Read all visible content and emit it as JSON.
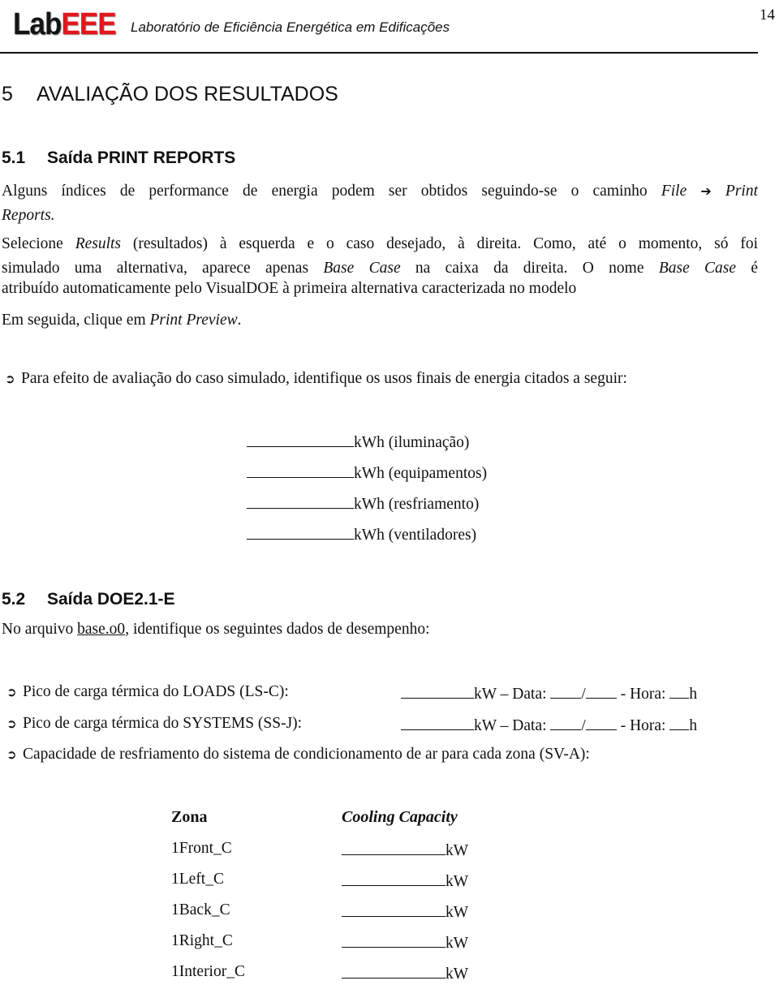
{
  "header": {
    "logo": {
      "part1": "Lab",
      "part2": "EEE"
    },
    "title": "Laboratório de Eficiência Energética em Edificações",
    "page_number": "14",
    "brand_colors": {
      "logo_black": "#141414",
      "logo_red": "#e0171d"
    }
  },
  "section5": {
    "number": "5",
    "title": "AVALIAÇÃO DOS RESULTADOS"
  },
  "section51": {
    "number": "5.1",
    "title": "Saída PRINT REPORTS",
    "para1": {
      "text": "Alguns índices de performance de energia podem ser obtidos seguindo-se o caminho",
      "path_from": "File",
      "arrow": "➔",
      "path_to_1": "Print",
      "path_to_2": "Reports."
    },
    "para2": {
      "line1_a": "Selecione",
      "line1_results": "Results",
      "line1_b": "(resultados) à esquerda e o caso desejado, à direita. Como, até o momento, só foi",
      "line2_a": "simulado uma alternativa, aparece apenas",
      "line2_base": "Base Case",
      "line2_b": "na caixa da direita. O nome",
      "line2_base2": "Base Case",
      "line2_c": "é",
      "line3": "atribuído automaticamente pelo VisualDOE à primeira alternativa caracterizada no modelo"
    },
    "para3": {
      "text": "Em seguida, clique em",
      "link": "Print Preview",
      "end": "."
    },
    "task": {
      "icon": "⮊",
      "text": "Para efeito de avaliação do caso simulado, identifique os usos finais de energia citados a seguir:"
    },
    "end_uses": [
      {
        "unit": "kWh",
        "label": "(iluminação)",
        "value": ""
      },
      {
        "unit": "kWh",
        "label": "(equipamentos)",
        "value": ""
      },
      {
        "unit": "kWh",
        "label": "(resfriamento)",
        "value": ""
      },
      {
        "unit": "kWh",
        "label": "(ventiladores)",
        "value": ""
      }
    ]
  },
  "section52": {
    "number": "5.2",
    "title": "Saída DOE2.1-E",
    "intro": {
      "text_a": "No arquivo",
      "file": "base.o0",
      "text_b": ", identifique os seguintes dados de desempenho:"
    },
    "peaks": [
      {
        "label": "Pico de carga térmica do LOADS (LS-C):",
        "unit": "kW – Data:",
        "slash": "/",
        "hour_label": "- Hora:",
        "hour_unit": "h"
      },
      {
        "label": "Pico de carga térmica do SYSTEMS (SS-J):",
        "unit": "kW – Data:",
        "slash": "/",
        "hour_label": "- Hora:",
        "hour_unit": "h"
      }
    ],
    "capacity_task": "Capacidade de resfriamento do sistema de condicionamento de ar para cada zona (SV-A):",
    "zone_table": {
      "headers": [
        "Zona",
        "Cooling Capacity"
      ],
      "rows": [
        {
          "zone": "1Front_C",
          "unit": "kW"
        },
        {
          "zone": "1Left_C",
          "unit": "kW"
        },
        {
          "zone": "1Back_C",
          "unit": "kW"
        },
        {
          "zone": "1Right_C",
          "unit": "kW"
        },
        {
          "zone": "1Interior_C",
          "unit": "kW"
        }
      ]
    }
  }
}
